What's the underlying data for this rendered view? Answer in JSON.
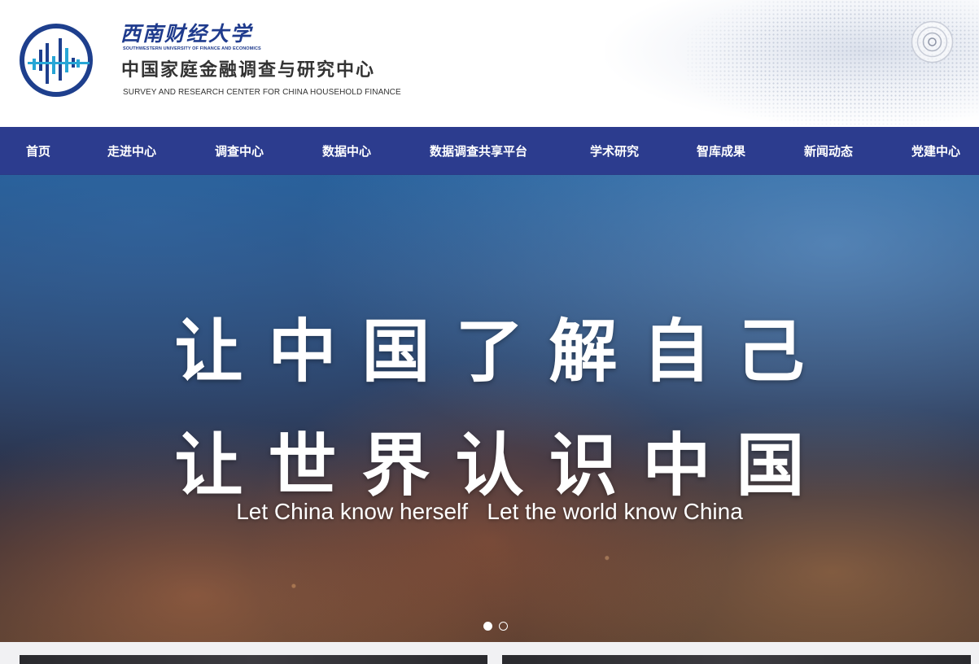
{
  "header": {
    "university_name": "西南财经大学",
    "university_name_en": "SOUTHWESTERN UNIVERSITY OF FINANCE AND ECONOMICS",
    "center_name": "中国家庭金融调查与研究中心",
    "center_name_en": "SURVEY AND RESEARCH CENTER  FOR CHINA HOUSEHOLD FINANCE",
    "logo_icon": "signal-bars-logo",
    "corner_icon": "target-icon"
  },
  "nav": {
    "items": [
      {
        "label": "首页"
      },
      {
        "label": "走进中心"
      },
      {
        "label": "调查中心"
      },
      {
        "label": "数据中心"
      },
      {
        "label": "数据调查共享平台"
      },
      {
        "label": "学术研究"
      },
      {
        "label": "智库成果"
      },
      {
        "label": "新闻动态"
      },
      {
        "label": "党建中心"
      }
    ]
  },
  "banner": {
    "line1": "让中国了解自己",
    "line2": "让世界认识中国",
    "en_part1": "Let China know herself",
    "en_part2": "Let the world know China",
    "slide_count": 2,
    "active_slide": 1
  },
  "colors": {
    "brand_blue": "#1f3b8d",
    "nav_bg": "#2c3c8e",
    "logo_accent": "#27a6d6"
  }
}
